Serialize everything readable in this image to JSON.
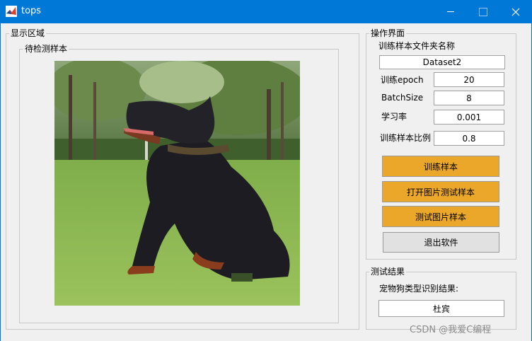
{
  "window": {
    "title": "tops"
  },
  "display_area": {
    "title": "显示区域",
    "image_panel_title": "待检测样本"
  },
  "operation": {
    "title": "操作界面",
    "folder_label": "训练样本文件夹名称",
    "folder_value": "Dataset2",
    "epoch_label": "训练epoch",
    "epoch_value": "20",
    "batch_label": "BatchSize",
    "batch_value": "8",
    "lr_label": "学习率",
    "lr_value": "0.001",
    "ratio_label": "训练样本比例",
    "ratio_value": "0.8",
    "buttons": {
      "train": "训练样本",
      "open_test": "打开图片测试样本",
      "test": "测试图片样本",
      "exit": "退出软件"
    }
  },
  "result": {
    "title": "测试结果",
    "label": "宠物狗类型识别结果:",
    "value": "杜宾"
  },
  "watermark": "CSDN @我爱C编程",
  "colors": {
    "titlebar": "#0078d7",
    "button_accent": "#eaa72a",
    "button_gray": "#e1e1e1"
  },
  "icons": {
    "app": "matlab-icon",
    "minimize": "minimize-icon",
    "maximize": "maximize-icon",
    "close": "close-icon"
  }
}
